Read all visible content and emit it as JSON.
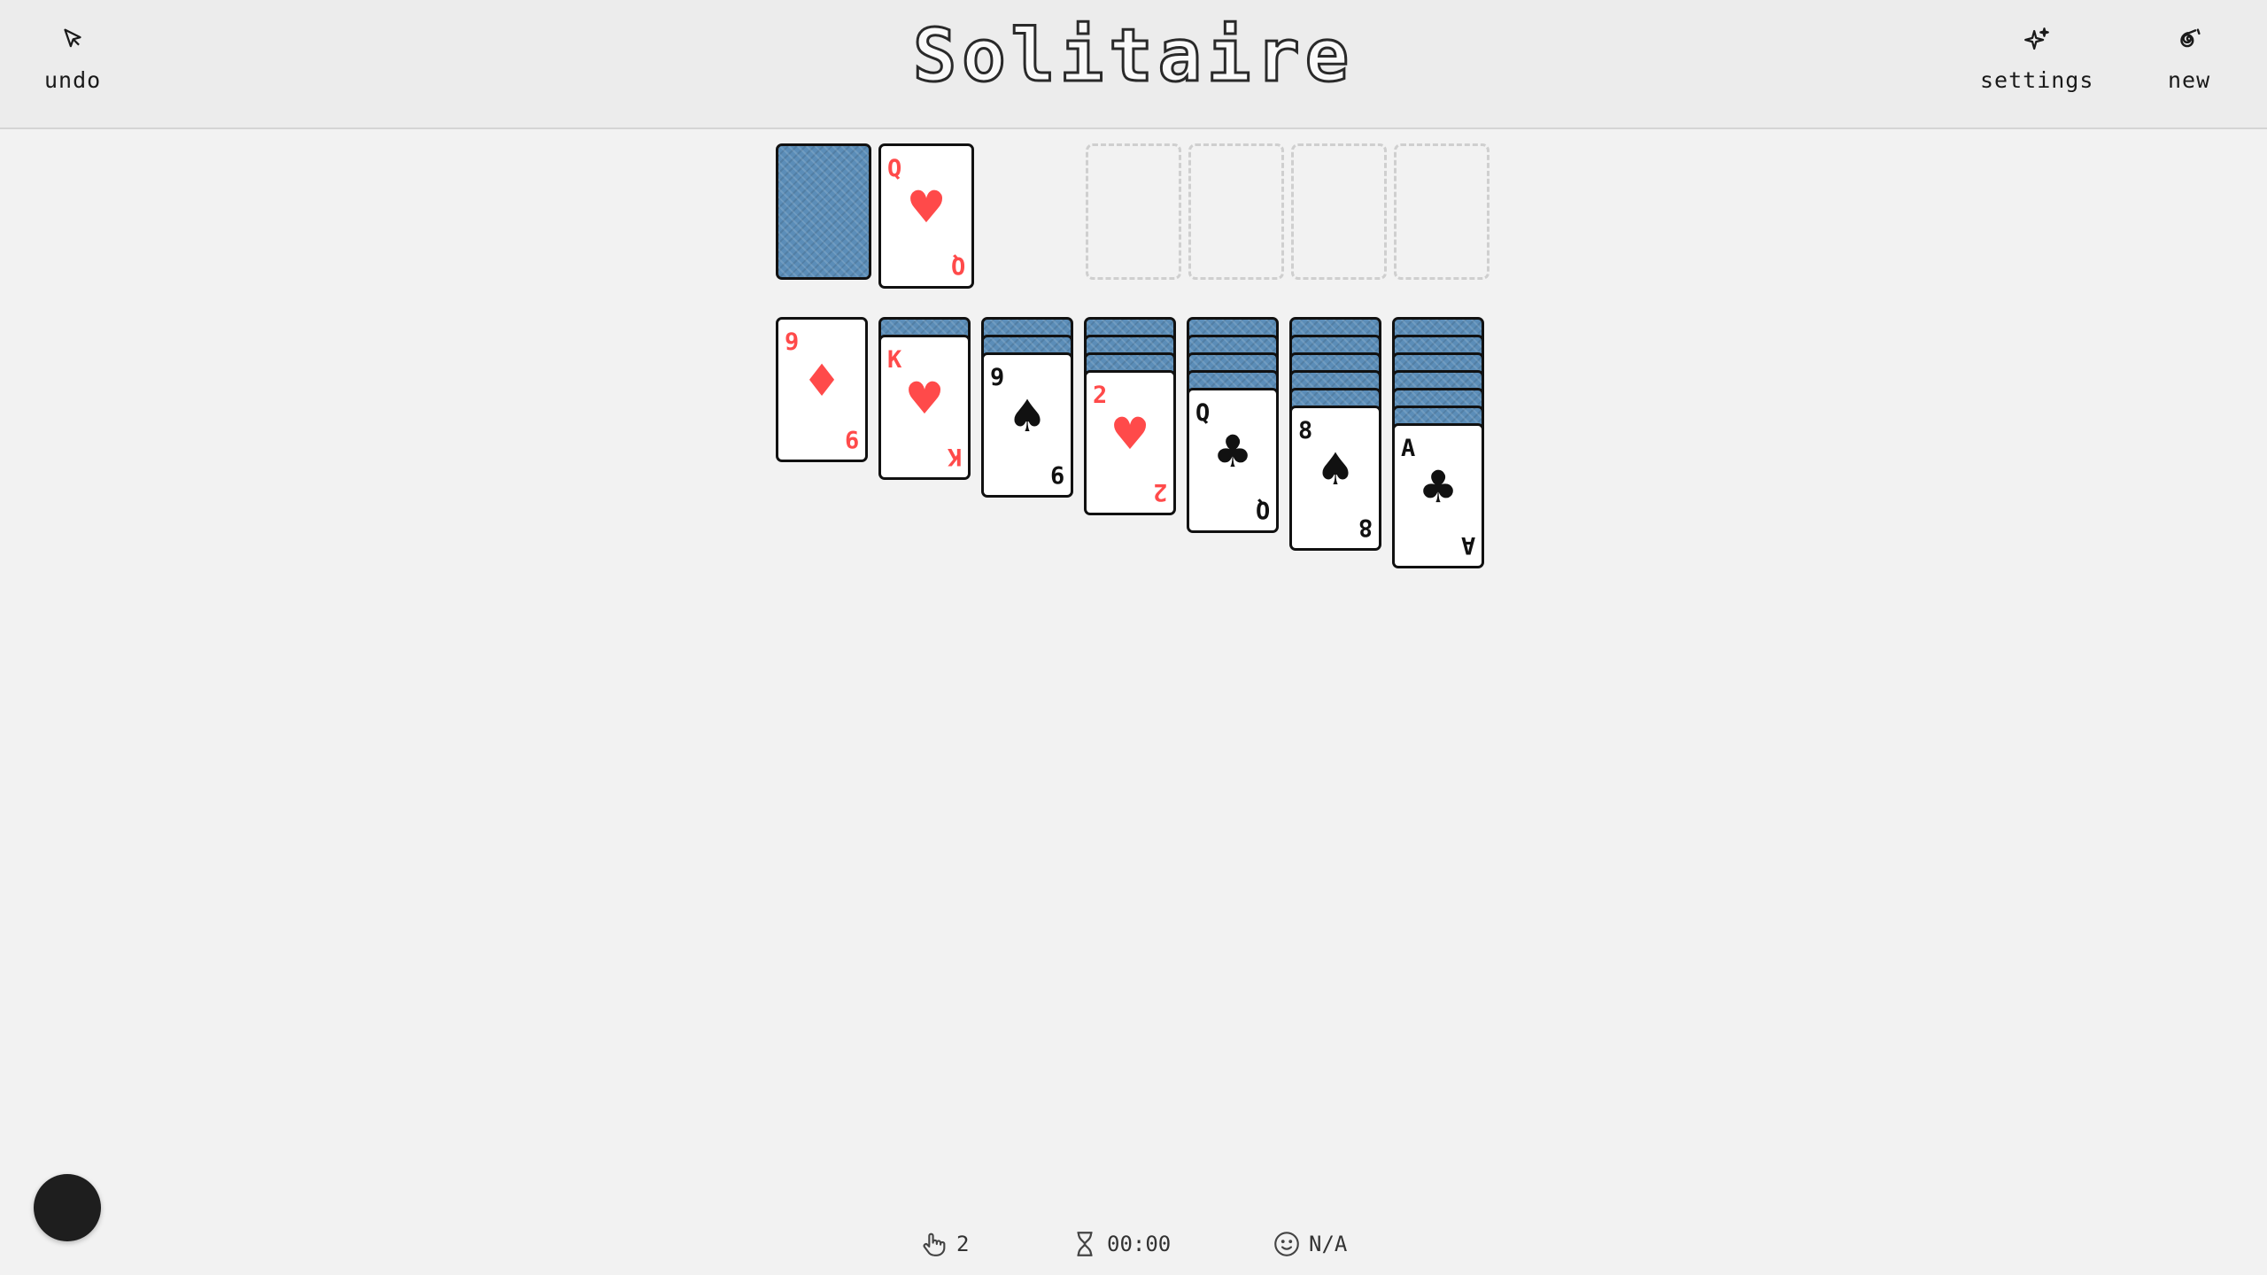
{
  "header": {
    "title": "Solitaire",
    "undo_label": "undo",
    "settings_label": "settings",
    "new_label": "new"
  },
  "stock": {
    "face_down": true
  },
  "waste": {
    "rank": "Q",
    "suit": "♥",
    "color": "red"
  },
  "foundations": [
    "",
    "",
    "",
    ""
  ],
  "tableau": [
    {
      "hidden": 0,
      "rank": "9",
      "suit": "♦",
      "color": "red"
    },
    {
      "hidden": 1,
      "rank": "K",
      "suit": "♥",
      "color": "red"
    },
    {
      "hidden": 2,
      "rank": "9",
      "suit": "♠",
      "color": "black"
    },
    {
      "hidden": 3,
      "rank": "2",
      "suit": "♥",
      "color": "red"
    },
    {
      "hidden": 4,
      "rank": "Q",
      "suit": "♣",
      "color": "black"
    },
    {
      "hidden": 5,
      "rank": "8",
      "suit": "♠",
      "color": "black"
    },
    {
      "hidden": 6,
      "rank": "A",
      "suit": "♣",
      "color": "black"
    }
  ],
  "status": {
    "moves": "2",
    "time": "00:00",
    "score": "N/A"
  },
  "colors": {
    "card_back": "#5b8db8",
    "red_suit": "#ff4a4a",
    "background": "#f2f2f2"
  }
}
